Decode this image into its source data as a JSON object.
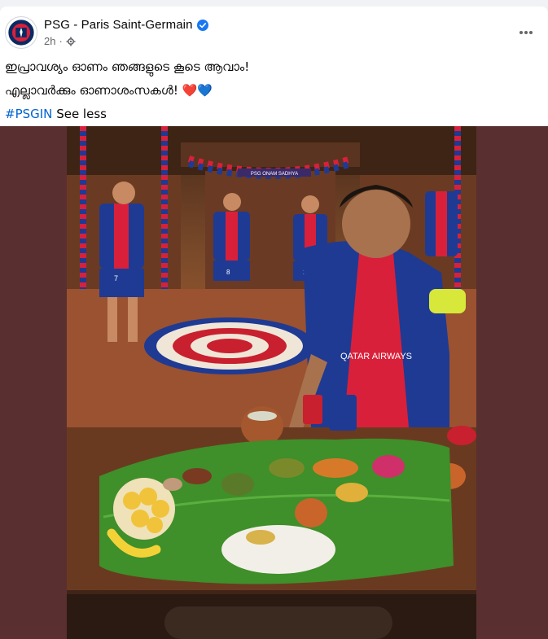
{
  "post": {
    "page_name": "PSG - Paris Saint-Germain",
    "time": "2h",
    "separator": "·",
    "line1": "ഇപ്രാവശ്യം ഓണം ഞങ്ങളുടെ കൂടെ ആവാം!",
    "line2": "എല്ലാവർക്കും ഓണാശംസകൾ!",
    "line2_emoji": "❤️💙",
    "hashtag": "#PSGIN",
    "see_less": "See less"
  },
  "photo": {
    "shirt_sponsor": "QATAR AIRWAYS",
    "shirt_numbers": [
      "7",
      "8",
      "12"
    ],
    "banner": "PSG ONAM SADHYA"
  },
  "colors": {
    "link": "#0064d1",
    "verified": "#1877f2",
    "psg_blue": "#1f3a93",
    "psg_red": "#d9203a",
    "leaf_green": "#3f8f2a",
    "media_bg": "#5a2f30"
  },
  "icons": {
    "verified": "verified-badge-icon",
    "audience": "globe-gear-icon",
    "more": "more-options-icon"
  }
}
